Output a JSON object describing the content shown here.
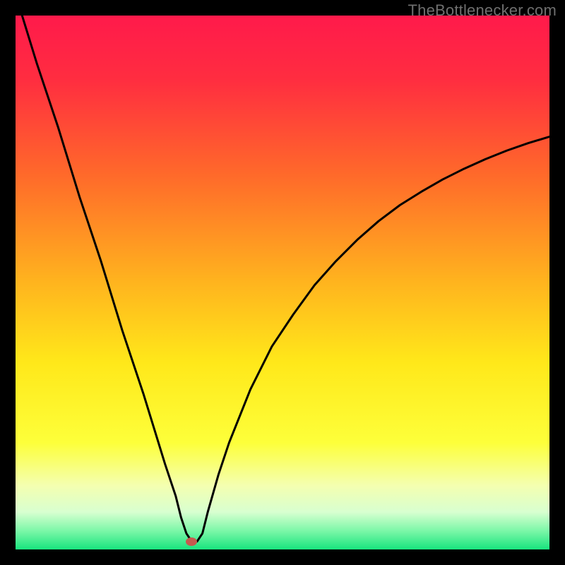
{
  "watermark": {
    "text": "TheBottlenecker.com"
  },
  "colors": {
    "frame": "#000000",
    "curve": "#000000",
    "marker": "#c65a4f",
    "gradient_stops": [
      {
        "pos": 0.0,
        "color": "#ff1a4b"
      },
      {
        "pos": 0.12,
        "color": "#ff2d40"
      },
      {
        "pos": 0.3,
        "color": "#ff6a2a"
      },
      {
        "pos": 0.5,
        "color": "#ffb41e"
      },
      {
        "pos": 0.65,
        "color": "#ffe81a"
      },
      {
        "pos": 0.8,
        "color": "#fdff3a"
      },
      {
        "pos": 0.88,
        "color": "#f4ffb0"
      },
      {
        "pos": 0.93,
        "color": "#d8ffd0"
      },
      {
        "pos": 0.965,
        "color": "#7cf7a8"
      },
      {
        "pos": 1.0,
        "color": "#18e47e"
      }
    ]
  },
  "chart_data": {
    "type": "line",
    "title": "",
    "xlabel": "",
    "ylabel": "",
    "xlim": [
      0,
      100
    ],
    "ylim": [
      0,
      100
    ],
    "grid": false,
    "legend": false,
    "annotations": [
      {
        "name": "optimal-point",
        "x": 33,
        "y": 1.5
      }
    ],
    "series": [
      {
        "name": "bottleneck-curve",
        "x": [
          0,
          4,
          8,
          12,
          16,
          20,
          24,
          28,
          30,
          31,
          32,
          33,
          34,
          35,
          36,
          38,
          40,
          44,
          48,
          52,
          56,
          60,
          64,
          68,
          72,
          76,
          80,
          84,
          88,
          92,
          96,
          100
        ],
        "y": [
          104,
          91,
          79,
          66,
          54,
          41,
          29,
          16,
          10,
          6,
          3,
          1.5,
          1.5,
          3,
          7,
          14,
          20,
          30,
          38,
          44,
          49.5,
          54,
          58,
          61.5,
          64.5,
          67,
          69.3,
          71.3,
          73.1,
          74.7,
          76.1,
          77.3
        ]
      }
    ]
  }
}
